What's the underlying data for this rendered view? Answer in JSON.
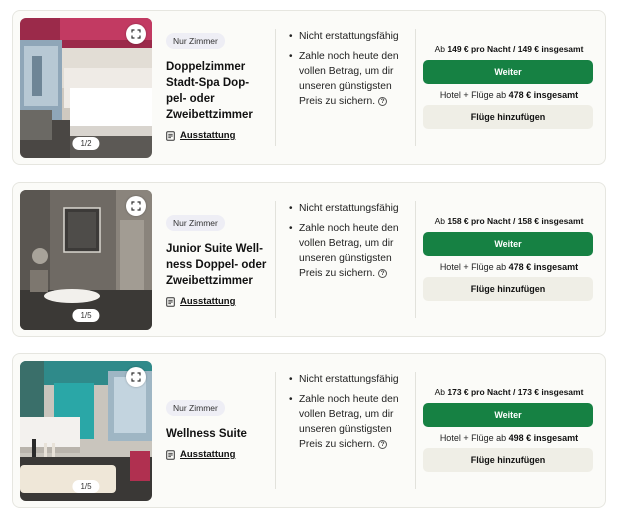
{
  "offers": [
    {
      "photo_counter": "1/2",
      "badge": "Nur Zimmer",
      "title_lines": [
        "Doppelzimmer",
        "Stadt-Spa Dop-",
        "pel- oder",
        "Zweibettzimmer"
      ],
      "amenities_label": "Ausstattung",
      "policy": [
        "Nicht erstattungsfähig",
        "Zahle noch heute den vollen Betrag, um dir unseren günstigsten Preis zu sichern."
      ],
      "price_prefix": "Ab",
      "price_per_night": "149 € pro Nacht / 149 € insgesamt",
      "continue_label": "Weiter",
      "flight_prefix": "Hotel + Flüge ab",
      "flight_price": "478 € insgesamt",
      "add_flights_label": "Flüge hinzufügen"
    },
    {
      "photo_counter": "1/5",
      "badge": "Nur Zimmer",
      "title_lines": [
        "Junior Suite Well-",
        "ness Doppel- oder",
        "Zweibettzimmer"
      ],
      "amenities_label": "Ausstattung",
      "policy": [
        "Nicht erstattungsfähig",
        "Zahle noch heute den vollen Betrag, um dir unseren günstigsten Preis zu sichern."
      ],
      "price_prefix": "Ab",
      "price_per_night": "158 € pro Nacht / 158 € insgesamt",
      "continue_label": "Weiter",
      "flight_prefix": "Hotel + Flüge ab",
      "flight_price": "478 € insgesamt",
      "add_flights_label": "Flüge hinzufügen"
    },
    {
      "photo_counter": "1/5",
      "badge": "Nur Zimmer",
      "title_lines": [
        "Wellness Suite"
      ],
      "amenities_label": "Ausstattung",
      "policy": [
        "Nicht erstattungsfähig",
        "Zahle noch heute den vollen Betrag, um dir unseren günstigsten Preis zu sichern."
      ],
      "price_prefix": "Ab",
      "price_per_night": "173 € pro Nacht / 173 € insgesamt",
      "continue_label": "Weiter",
      "flight_prefix": "Hotel + Flüge ab",
      "flight_price": "498 € insgesamt",
      "add_flights_label": "Flüge hinzufügen"
    }
  ],
  "icons": {
    "expand": "expand-icon",
    "amenities": "document-icon",
    "info": "info-icon"
  },
  "colors": {
    "primary_button": "#168143",
    "secondary_button": "#efeee6",
    "badge_bg": "#eeeef5",
    "card_bg": "#fbfbf8"
  }
}
